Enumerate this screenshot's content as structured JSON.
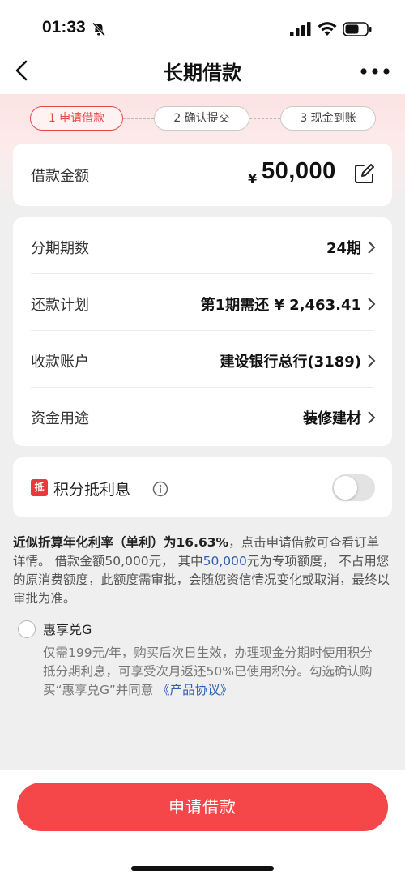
{
  "status_bar": {
    "time": "01:33"
  },
  "nav": {
    "title": "长期借款"
  },
  "steps": [
    {
      "label": "1 申请借款",
      "active": true
    },
    {
      "label": "2 确认提交",
      "active": false
    },
    {
      "label": "3 现金到账",
      "active": false
    }
  ],
  "amount": {
    "label": "借款金额",
    "currency": "¥",
    "value": "50,000"
  },
  "details": [
    {
      "label": "分期期数",
      "value": "24期"
    },
    {
      "label": "还款计划",
      "value": "第1期需还 ¥ 2,463.41"
    },
    {
      "label": "收款账户",
      "value": "建设银行总行(3189)"
    },
    {
      "label": "资金用途",
      "value": "装修建材"
    }
  ],
  "points": {
    "badge": "抵",
    "label": "积分抵利息",
    "enabled": false
  },
  "disclaimer": {
    "bold_text": "近似折算年化利率（单利）为16.63%",
    "text_1": "，点击申请借款可查看订单详情。 借款金额50,000元， 其中",
    "link_amount": "50,000",
    "text_2": "元为专项额度， 不占用您的原消费额度，此额度需审批，会随您资信情况变化或取消，最终以审批为准。"
  },
  "hui_xiang": {
    "title": "惠享兑G",
    "desc": "仅需199元/年，购买后次日生效，办理现金分期时使用积分抵分期利息，可享受次月返还50%已使用积分。勾选确认购买“惠享兑G”并同意 ",
    "link": "《产品协议》"
  },
  "apply_button": {
    "label": "申请借款"
  },
  "colors": {
    "accent": "#f5474a",
    "link": "#2f5fb3",
    "background": "#efefef"
  }
}
